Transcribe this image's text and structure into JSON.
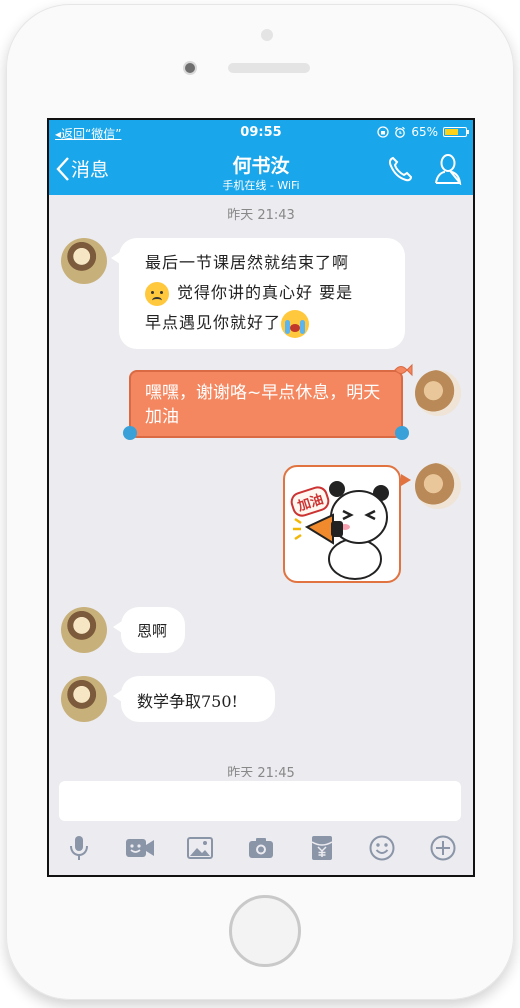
{
  "status_bar": {
    "back_label": "返回“微信”",
    "time": "09:55",
    "battery_percent_label": "65%",
    "battery_level": 0.65
  },
  "nav_bar": {
    "back_label": "消息",
    "contact_name": "何书汝",
    "contact_status": "手机在线 - WiFi"
  },
  "chat": {
    "timestamp_1": "昨天 21:43",
    "messages": [
      {
        "sender": "friend",
        "lines": [
          "最后一节课居然就结束了啊",
          "觉得你讲的真心好 要是",
          "早点遇见你就好了"
        ]
      },
      {
        "sender": "me",
        "text": "嘿嘿，谢谢咯~早点休息，明天加油"
      },
      {
        "sender": "me",
        "type": "sticker",
        "sticker_text": "加油"
      },
      {
        "sender": "friend",
        "text": "恩啊"
      },
      {
        "sender": "friend",
        "text": "数学争取750!"
      }
    ],
    "timestamp_2": "昨天 21:45"
  },
  "input": {
    "value": "",
    "placeholder": ""
  },
  "toolbar": {
    "icons": [
      "microphone-icon",
      "video-call-icon",
      "image-icon",
      "camera-icon",
      "red-packet-icon",
      "emoji-icon",
      "plus-icon"
    ]
  },
  "colors": {
    "accent_blue": "#1aa6ea",
    "bubble_orange": "#f4875f",
    "chat_background": "#ebebf0"
  }
}
